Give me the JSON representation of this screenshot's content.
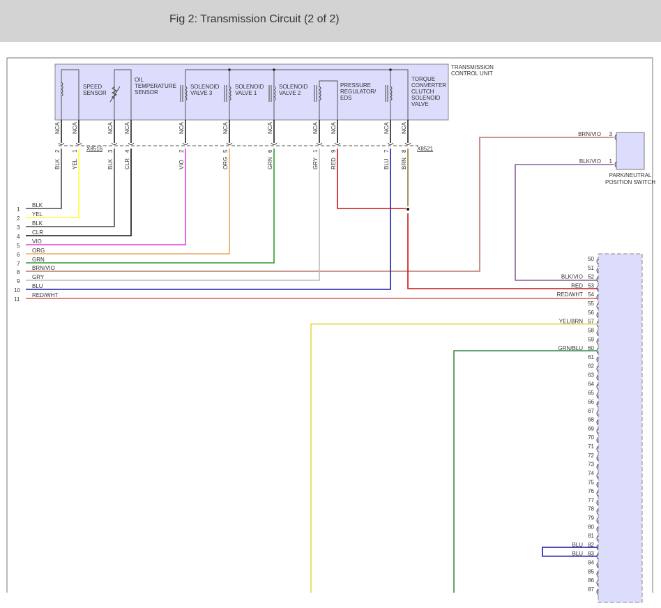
{
  "header": {
    "title": "Fig 2: Transmission Circuit (2 of 2)"
  },
  "tcu": {
    "label": [
      "TRANSMISSION",
      "CONTROL UNIT"
    ],
    "components": [
      {
        "id": "speed-sensor",
        "lines": [
          "SPEED",
          "SENSOR"
        ]
      },
      {
        "id": "oil-temperature-sensor",
        "lines": [
          "OIL",
          "TEMPERATURE",
          "SENSOR"
        ]
      },
      {
        "id": "solenoid-valve-3",
        "lines": [
          "SOLENOID",
          "VALVE 3"
        ]
      },
      {
        "id": "solenoid-valve-1",
        "lines": [
          "SOLENOID",
          "VALVE 1"
        ]
      },
      {
        "id": "solenoid-valve-2",
        "lines": [
          "SOLENOID",
          "VALVE 2"
        ]
      },
      {
        "id": "pressure-regulator-eds",
        "lines": [
          "PRESSURE",
          "REGULATOR/",
          "EDS"
        ]
      },
      {
        "id": "torque-converter-clutch-solenoid-valve",
        "lines": [
          "TORQUE",
          "CONVERTER",
          "CLUTCH",
          "SOLENOID",
          "VALVE"
        ]
      }
    ],
    "pins": [
      {
        "nca": "NCA",
        "pin": "2",
        "color": "BLK"
      },
      {
        "nca": "NCA",
        "pin": "1",
        "color": "YEL"
      },
      {
        "nca": "NCA",
        "pin": "3",
        "color": "BLK"
      },
      {
        "nca": "NCA",
        "pin": "4",
        "color": "CLR"
      },
      {
        "nca": "NCA",
        "pin": "2",
        "color": "VIO"
      },
      {
        "nca": "NCA",
        "pin": "5",
        "color": "ORG"
      },
      {
        "nca": "NCA",
        "pin": "6",
        "color": "GRN"
      },
      {
        "nca": "NCA",
        "pin": "1",
        "color": "GRY"
      },
      {
        "nca": "NCA",
        "pin": "9",
        "color": "RED"
      },
      {
        "nca": "NCA",
        "pin": "7",
        "color": "BLU"
      },
      {
        "nca": "NCA",
        "pin": "8",
        "color": "BRN"
      }
    ],
    "connectors": [
      "X8516",
      "X8521"
    ]
  },
  "left_harness": [
    {
      "num": "1",
      "label": "BLK"
    },
    {
      "num": "2",
      "label": "YEL"
    },
    {
      "num": "3",
      "label": "BLK"
    },
    {
      "num": "4",
      "label": "CLR"
    },
    {
      "num": "5",
      "label": "VIO"
    },
    {
      "num": "6",
      "label": "ORG"
    },
    {
      "num": "7",
      "label": "GRN"
    },
    {
      "num": "8",
      "label": "BRN/VIO"
    },
    {
      "num": "9",
      "label": "GRY"
    },
    {
      "num": "10",
      "label": "BLU"
    },
    {
      "num": "11",
      "label": "RED/WHT"
    }
  ],
  "park_switch": {
    "label": [
      "PARK/NEUTRAL",
      "POSITION SWITCH"
    ],
    "pins": [
      {
        "pin": "3",
        "label": "BRN/VIO"
      },
      {
        "pin": "1",
        "label": "BLK/VIO"
      }
    ]
  },
  "right_connector": {
    "first_pin": 50,
    "last_pin": 87,
    "wire_labels": {
      "52": "BLK/VIO",
      "53": "RED",
      "54": "RED/WHT",
      "57": "YEL/BRN",
      "60": "GRN/BLU",
      "82": "BLU",
      "83": "BLU"
    }
  },
  "colors": {
    "BLK": "#4a4a4a",
    "YEL": "#ffff30",
    "CLR": "#111111",
    "VIO": "#e040e0",
    "ORG": "#e8a860",
    "GRN": "#2f9a2f",
    "BRN/VIO": "#b87868",
    "GRY": "#bbbbbb",
    "BLU": "#1818b0",
    "RED/WHT": "#d85a5a",
    "RED": "#cc1111",
    "BRN": "#8a7a3a",
    "BLK/VIO": "#8a5a9a",
    "YEL/BRN": "#e6d840",
    "GRN/BLU": "#3a8a4a",
    "module_fill": "#dcdcfc"
  }
}
